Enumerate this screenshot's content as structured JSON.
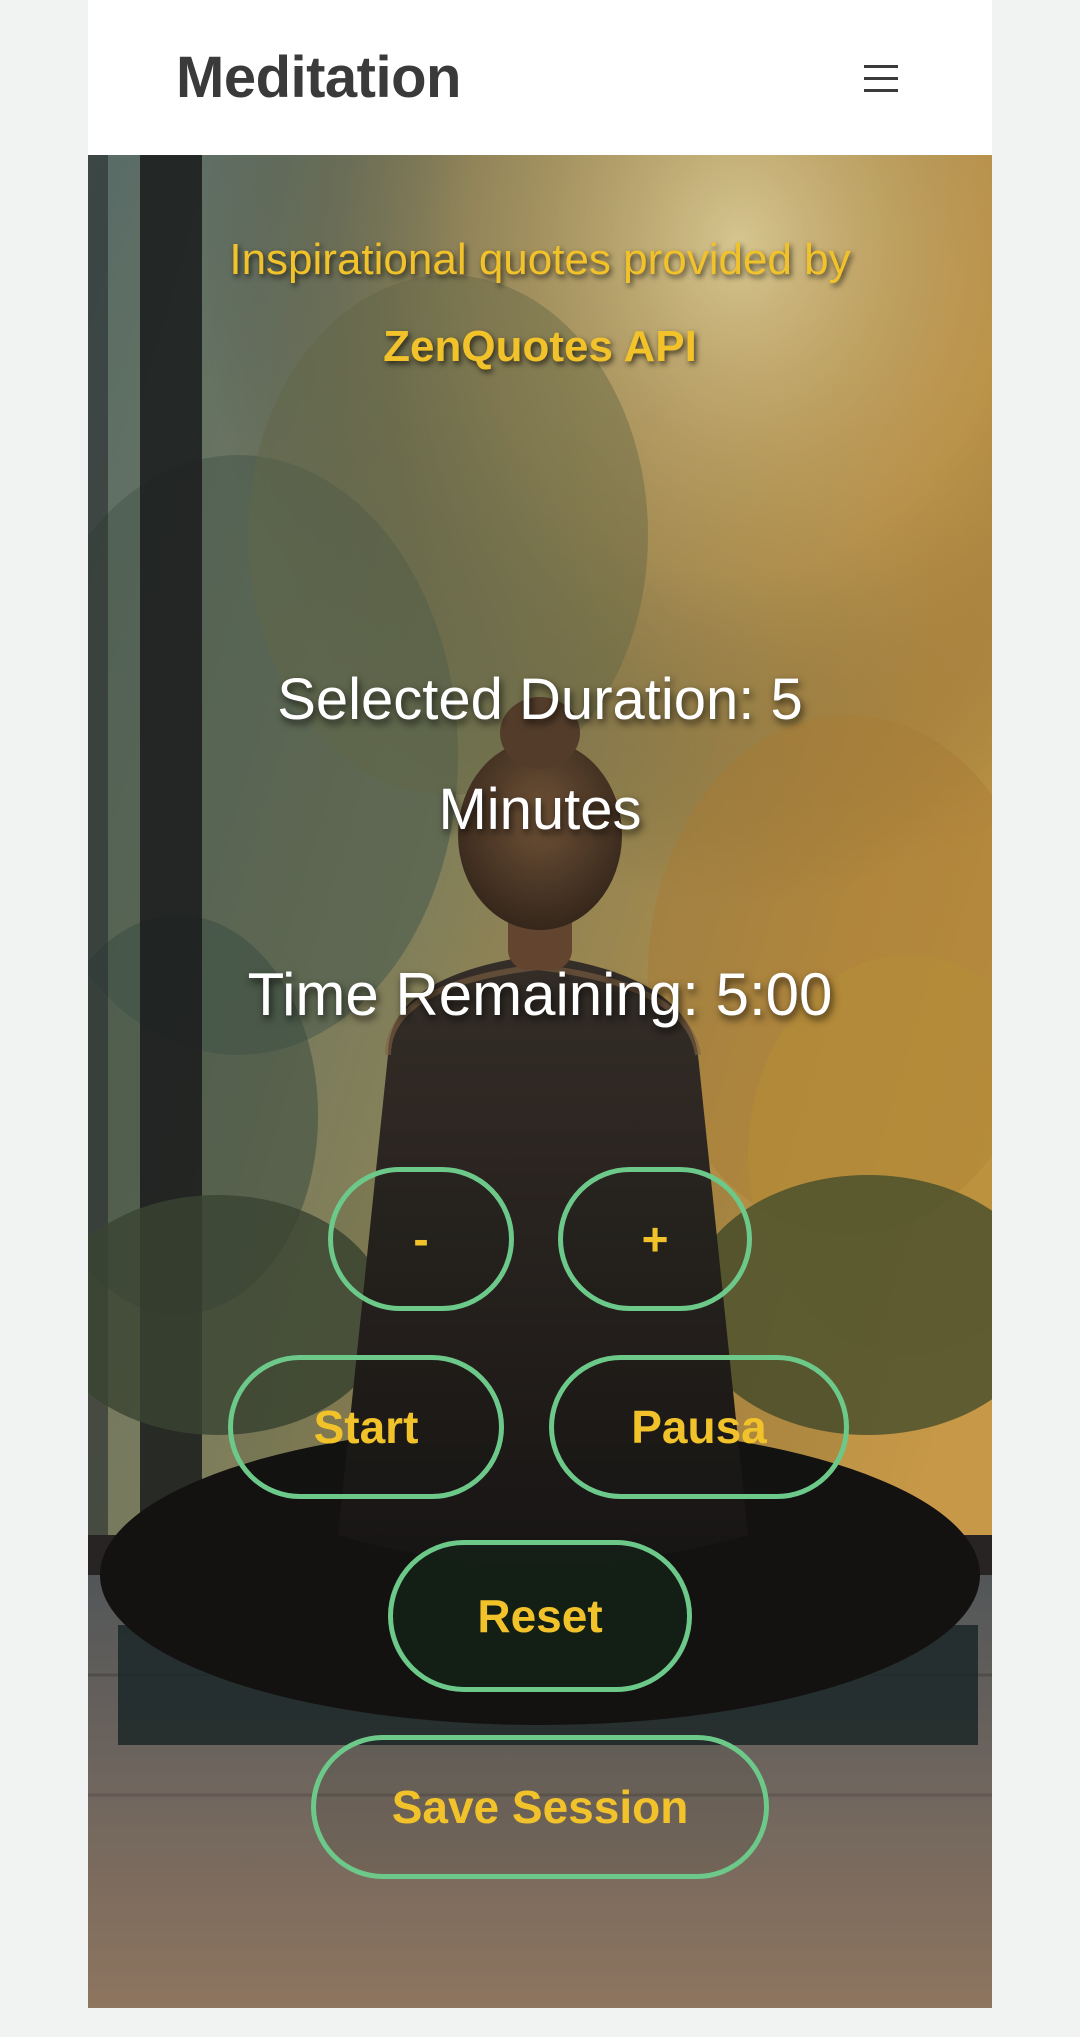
{
  "navbar": {
    "brand": "Meditation",
    "menu_icon": "hamburger-menu-icon"
  },
  "credits": {
    "line1": "Inspirational quotes provided by",
    "link": "ZenQuotes API"
  },
  "timer": {
    "selected_duration": "Selected Duration: 5 Minutes",
    "time_remaining": "Time Remaining: 5:00"
  },
  "buttons": {
    "decrease": "-",
    "increase": "+",
    "start": "Start",
    "pause": "Pausa",
    "reset": "Reset",
    "save": "Save Session"
  },
  "colors": {
    "accent_text": "#f2c22a",
    "button_border": "#6cc98a",
    "navbar_bg": "#ffffff",
    "brand_text": "#3a3a3a"
  }
}
